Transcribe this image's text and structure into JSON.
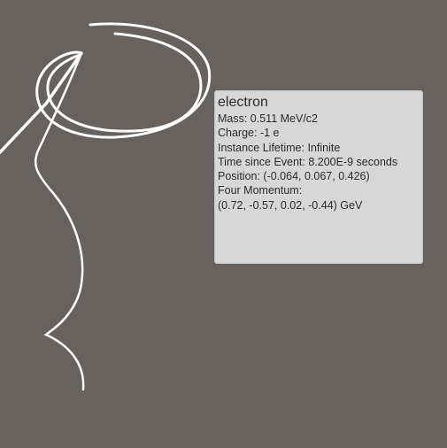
{
  "viewer": {
    "background_color": "#67625d",
    "track_color": "#ffffff"
  },
  "particle_info": {
    "name": "electron",
    "mass": "Mass: 0.511 MeV/c2",
    "charge": "Charge: -1 e",
    "lifetime": "Instance Lifetime: Infinite",
    "time_since_event": "Time since Event: 8.200E-9 seconds",
    "position": "Position: (-0.064, 0.067, 0.426)",
    "four_momentum_label": "Four Momentum:",
    "four_momentum_value": "(0.72, -0.57, 0.02, -0.44) GeV"
  }
}
